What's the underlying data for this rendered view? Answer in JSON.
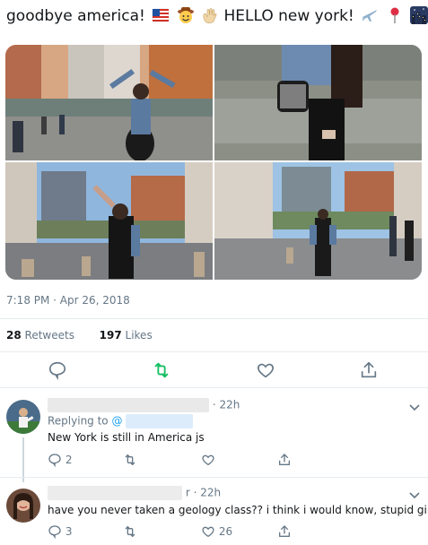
{
  "tweet": {
    "text_part1": "goodbye america!",
    "text_part2": "HELLO new york!",
    "timestamp": "7:18 PM · Apr 26, 2018",
    "retweets_count": "28",
    "retweets_label": "Retweets",
    "likes_count": "197",
    "likes_label": "Likes"
  },
  "emojis": [
    "us-flag-icon",
    "cowboy-face-icon",
    "waving-hand-icon",
    "airplane-icon",
    "round-pushpin-icon",
    "night-city-icon"
  ],
  "colors": {
    "accent": "#1da1f2",
    "retweet_green": "#17bf63",
    "muted": "#657786",
    "divider": "#e6ecf0"
  },
  "replies": [
    {
      "time": "· 22h",
      "replying_to_label": "Replying to",
      "replying_to_handle": "@",
      "text": "New York is still in America js",
      "reply_count": "2",
      "retweet_count": "",
      "like_count": ""
    },
    {
      "time": "r · 22h",
      "text": "have you never taken a geology class?? i think i would know, stupid girl.",
      "reply_count": "3",
      "retweet_count": "",
      "like_count": "26"
    }
  ]
}
